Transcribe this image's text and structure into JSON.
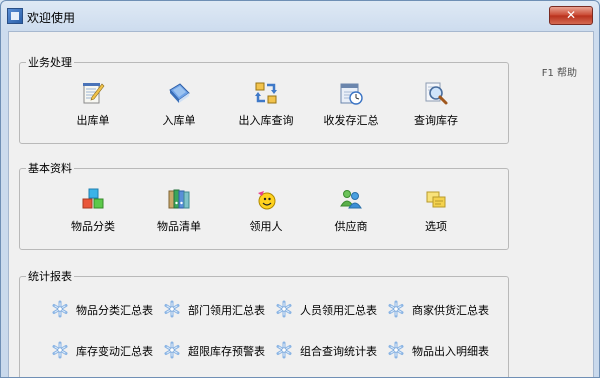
{
  "window": {
    "title": "欢迎使用",
    "close_label": "✕"
  },
  "help": {
    "label": "F1 帮助"
  },
  "business": {
    "title": "业务处理",
    "items": [
      {
        "label": "出库单",
        "icon": "notepad-pencil-icon"
      },
      {
        "label": "入库单",
        "icon": "blue-book-icon"
      },
      {
        "label": "出入库查询",
        "icon": "exchange-arrows-icon"
      },
      {
        "label": "收发存汇总",
        "icon": "calendar-clock-icon"
      },
      {
        "label": "查询库存",
        "icon": "magnifier-icon"
      }
    ]
  },
  "basic": {
    "title": "基本资料",
    "items": [
      {
        "label": "物品分类",
        "icon": "colored-cubes-icon"
      },
      {
        "label": "物品清单",
        "icon": "binders-icon"
      },
      {
        "label": "领用人",
        "icon": "smiley-person-icon"
      },
      {
        "label": "供应商",
        "icon": "people-group-icon"
      },
      {
        "label": "选项",
        "icon": "sticky-notes-icon"
      }
    ]
  },
  "reports": {
    "title": "统计报表",
    "items": [
      {
        "label": "物品分类汇总表",
        "icon": "snowflake-icon"
      },
      {
        "label": "部门领用汇总表",
        "icon": "snowflake-icon"
      },
      {
        "label": "人员领用汇总表",
        "icon": "snowflake-icon"
      },
      {
        "label": "商家供货汇总表",
        "icon": "snowflake-icon"
      },
      {
        "label": "库存变动汇总表",
        "icon": "snowflake-icon"
      },
      {
        "label": "超限库存预警表",
        "icon": "snowflake-icon"
      },
      {
        "label": "组合查询统计表",
        "icon": "snowflake-icon"
      },
      {
        "label": "物品出入明细表",
        "icon": "snowflake-icon"
      }
    ]
  }
}
